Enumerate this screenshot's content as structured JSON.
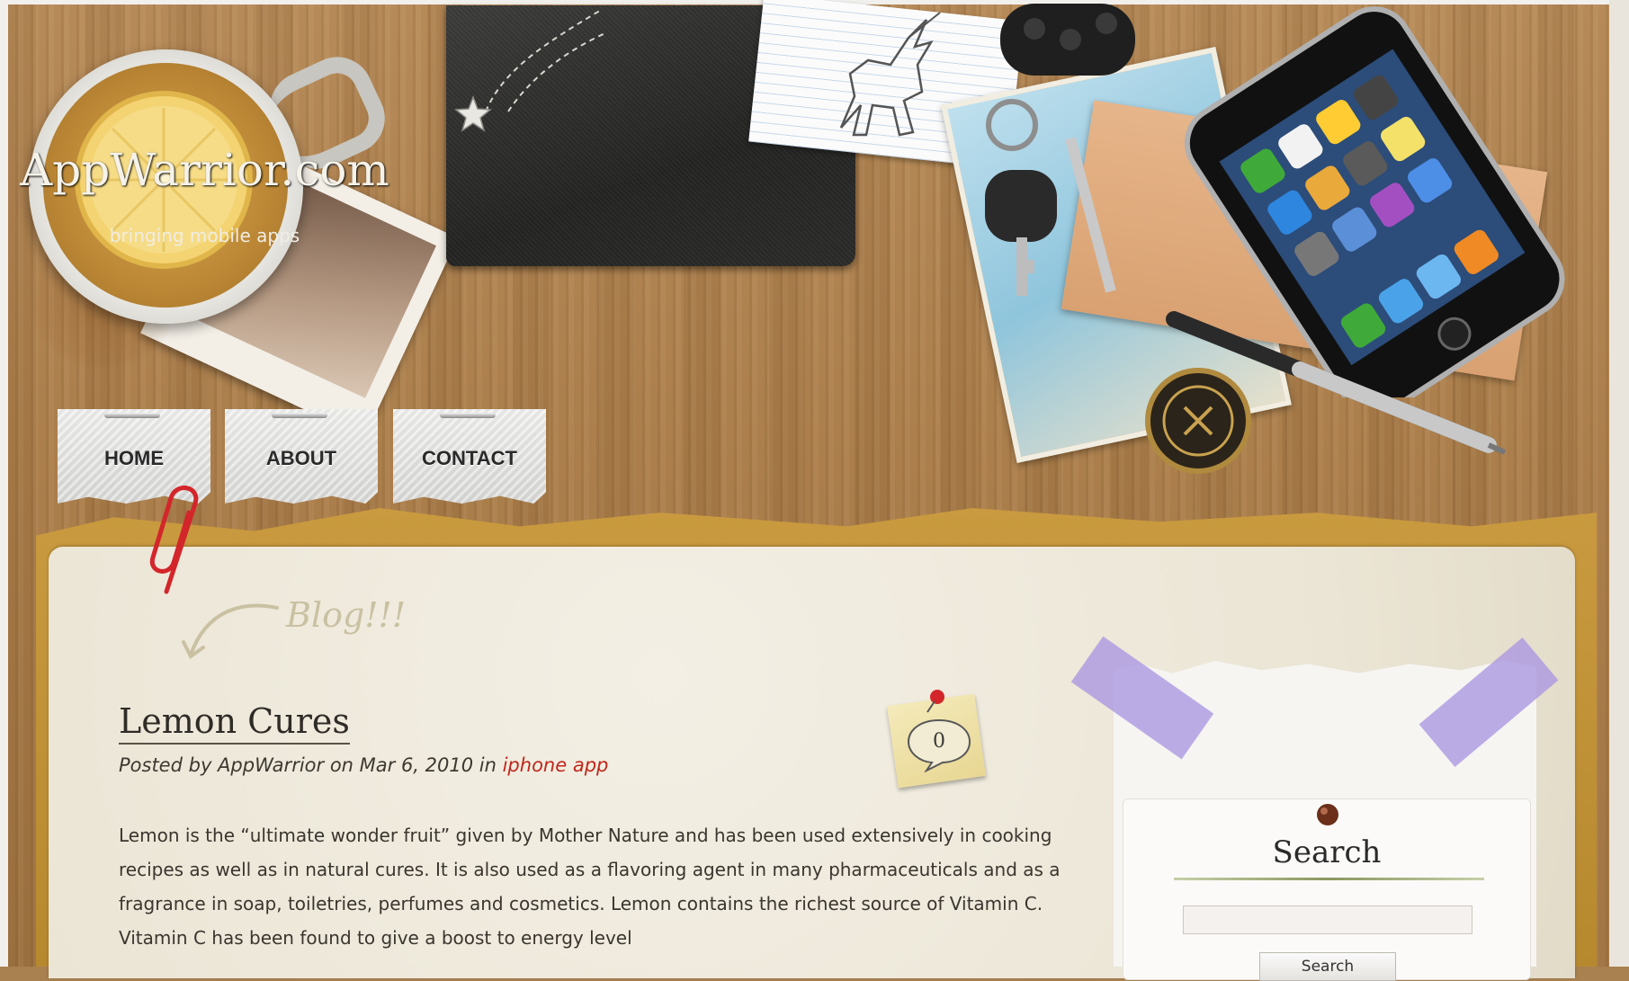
{
  "header": {
    "site_title": "AppWarrior.com",
    "tagline": "bringing mobile apps"
  },
  "nav": {
    "items": [
      {
        "label": "HOME"
      },
      {
        "label": "ABOUT"
      },
      {
        "label": "CONTACT"
      }
    ]
  },
  "blog": {
    "heading": "Blog!!!"
  },
  "post": {
    "title": "Lemon Cures",
    "meta_prefix": "Posted by AppWarrior on Mar 6, 2010 in ",
    "category": "iphone app",
    "comment_count": "0",
    "body": "Lemon is the “ultimate wonder fruit” given by Mother Nature and has been used extensively in cooking recipes as well as in natural cures. It is also used as a flavoring agent in many pharmaceuticals and as a fragrance in soap, toiletries, perfumes and cosmetics. Lemon contains the richest source of Vitamin C. Vitamin C has been found to give a boost to energy level"
  },
  "sidebar": {
    "search": {
      "heading": "Search",
      "input_value": "",
      "button_label": "Search"
    }
  },
  "colors": {
    "link_red": "#c0271b",
    "wood": "#a97d4b",
    "chalkboard": "#2b2b29",
    "panel": "#ebe5d5",
    "tape": "#aa96e1"
  },
  "icons": [
    "star-icon",
    "unicorn-icon",
    "lemon-icon",
    "keys-icon",
    "phone-icon",
    "pen-icon",
    "coin-icon",
    "paperclip-icon",
    "arrow-icon",
    "pin-icon",
    "comment-bubble-icon"
  ]
}
